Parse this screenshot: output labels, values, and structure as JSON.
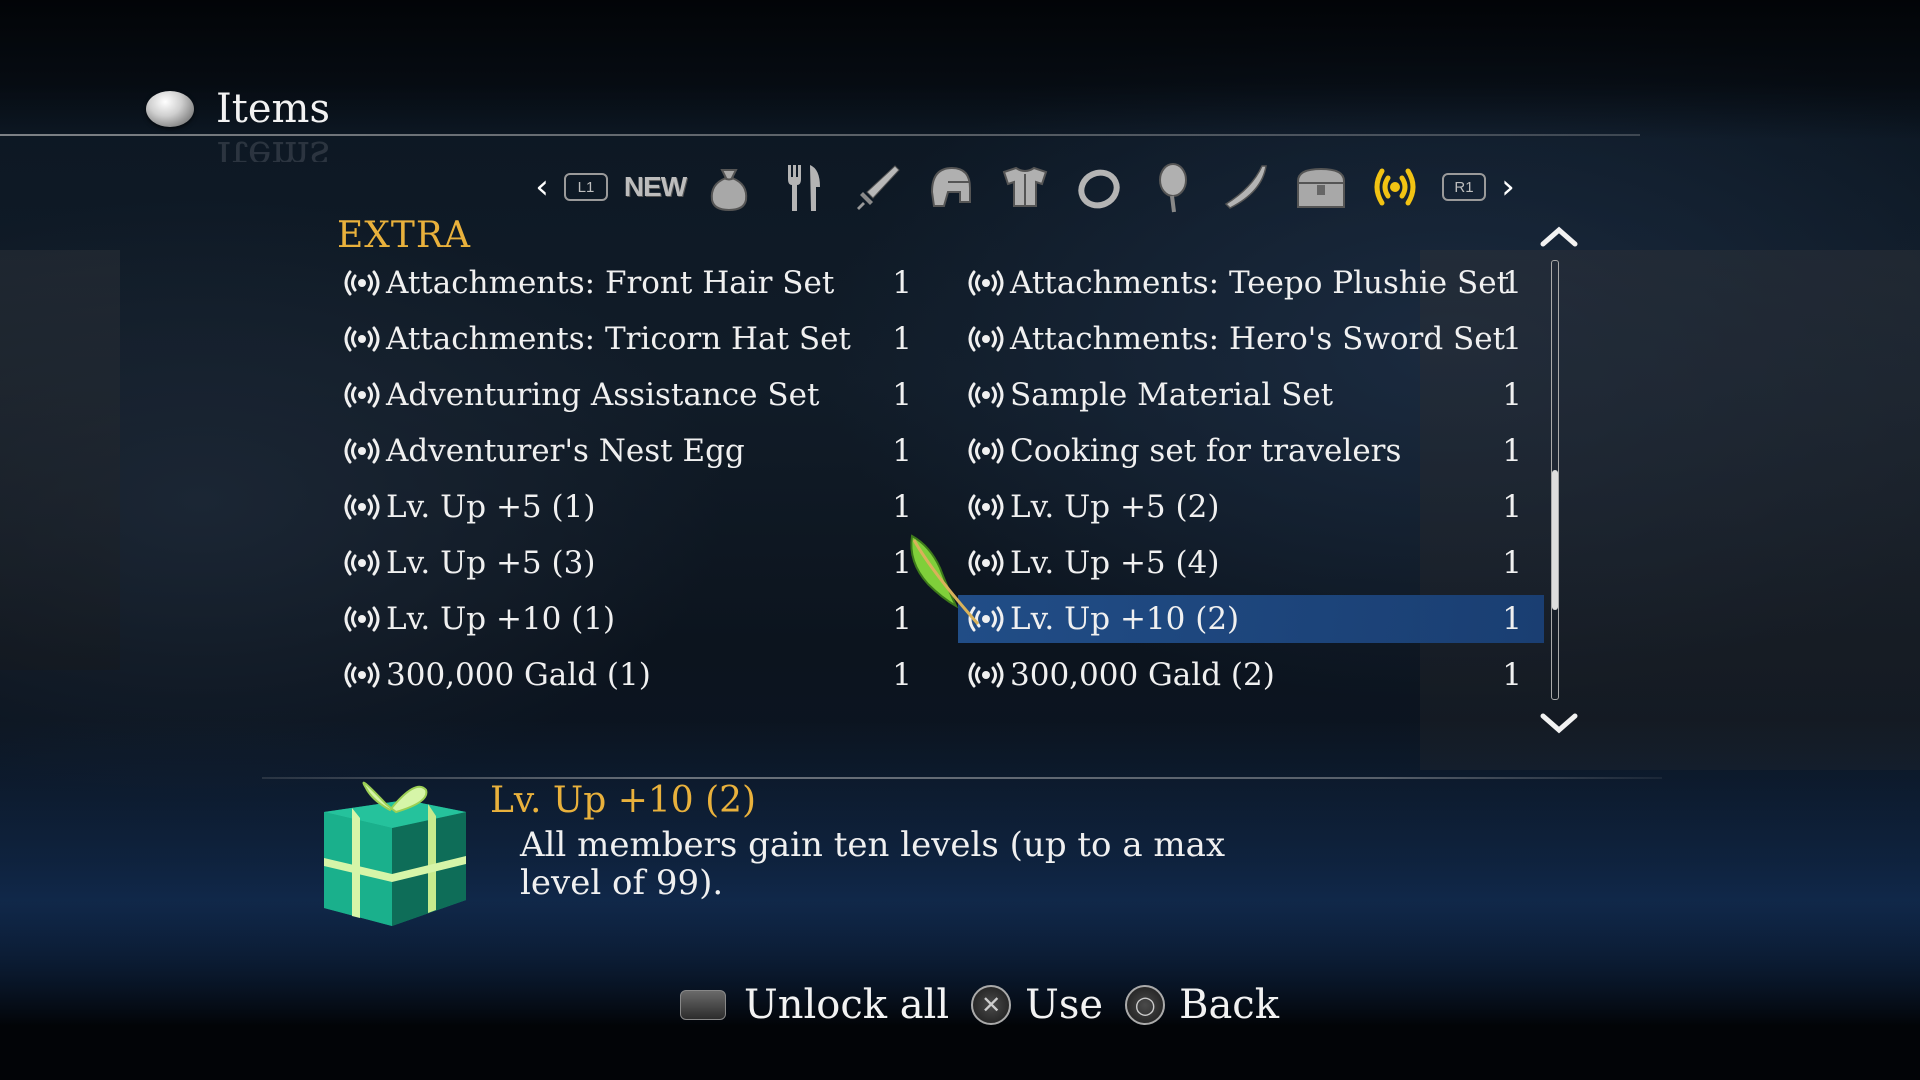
{
  "header": {
    "title": "Items"
  },
  "tabs": {
    "left_button": "L1",
    "right_button": "R1",
    "items": [
      {
        "name": "new",
        "label": "NEW"
      },
      {
        "name": "pouch",
        "icon": "pouch-icon"
      },
      {
        "name": "food",
        "icon": "fork-knife-icon"
      },
      {
        "name": "weapon",
        "icon": "sword-icon"
      },
      {
        "name": "helmet",
        "icon": "helmet-icon"
      },
      {
        "name": "armor",
        "icon": "armor-icon"
      },
      {
        "name": "ring",
        "icon": "ring-icon"
      },
      {
        "name": "material",
        "icon": "egg-icon"
      },
      {
        "name": "valuable",
        "icon": "horn-icon"
      },
      {
        "name": "chest",
        "icon": "chest-icon"
      },
      {
        "name": "extra",
        "icon": "broadcast-icon",
        "active": true
      }
    ]
  },
  "category": "EXTRA",
  "items_left": [
    {
      "name": "Attachments: Front Hair Set",
      "qty": "1"
    },
    {
      "name": "Attachments: Tricorn Hat Set",
      "qty": "1"
    },
    {
      "name": "Adventuring Assistance Set",
      "qty": "1"
    },
    {
      "name": "Adventurer's Nest Egg",
      "qty": "1"
    },
    {
      "name": "Lv. Up +5 (1)",
      "qty": "1"
    },
    {
      "name": "Lv. Up +5 (3)",
      "qty": "1"
    },
    {
      "name": "Lv. Up +10 (1)",
      "qty": "1"
    },
    {
      "name": "300,000 Gald (1)",
      "qty": "1"
    }
  ],
  "items_right": [
    {
      "name": "Attachments: Teepo Plushie Set",
      "qty": "1"
    },
    {
      "name": "Attachments: Hero's Sword Set",
      "qty": "1"
    },
    {
      "name": "Sample Material Set",
      "qty": "1"
    },
    {
      "name": "Cooking set for travelers",
      "qty": "1"
    },
    {
      "name": "Lv. Up +5 (2)",
      "qty": "1"
    },
    {
      "name": "Lv. Up +5 (4)",
      "qty": "1"
    },
    {
      "name": "Lv. Up +10 (2)",
      "qty": "1",
      "selected": true
    },
    {
      "name": "300,000 Gald (2)",
      "qty": "1"
    }
  ],
  "description": {
    "title": "Lv. Up +10 (2)",
    "text": "All members gain ten levels (up to a max level of 99)."
  },
  "footer": {
    "unlock_label": "Unlock all",
    "use_label": "Use",
    "back_label": "Back"
  },
  "colors": {
    "accent": "#e9b13c",
    "selection": "#1e4a86",
    "gift": "#1aa88a"
  }
}
